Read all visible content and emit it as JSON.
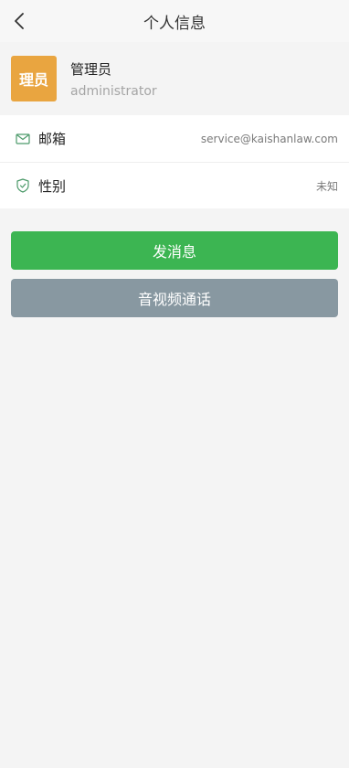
{
  "navbar": {
    "title": "个人信息",
    "back_icon": "chevron-left-icon"
  },
  "profile": {
    "avatar_text": "理员",
    "avatar_color": "#e9a540",
    "nickname": "管理员",
    "username": "administrator"
  },
  "info": [
    {
      "icon": "mail-icon",
      "label": "邮箱",
      "value": "service@kaishanlaw.com"
    },
    {
      "icon": "shield-icon",
      "label": "性别",
      "value": "未知"
    }
  ],
  "actions": {
    "send_message": "发消息",
    "send_message_color": "#3cb552",
    "av_call": "音视频通话",
    "av_call_color": "#8898a1"
  }
}
